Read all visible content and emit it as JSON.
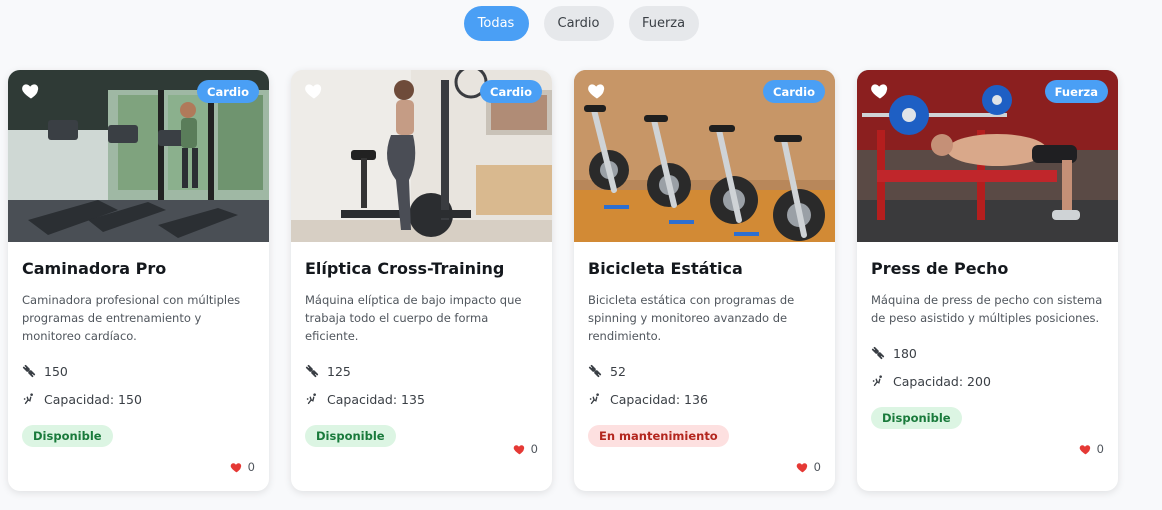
{
  "filters": [
    {
      "label": "Todas",
      "active": true
    },
    {
      "label": "Cardio",
      "active": false
    },
    {
      "label": "Fuerza",
      "active": false
    }
  ],
  "cards": [
    {
      "category": "Cardio",
      "title": "Caminadora Pro",
      "description": "Caminadora profesional con múltiples programas de entrenamiento y monitoreo cardíaco.",
      "weight": "150",
      "capacity": "Capacidad: 150",
      "status": "Disponible",
      "likes": "0",
      "image": "treadmill-row-icon"
    },
    {
      "category": "Cardio",
      "title": "Elíptica Cross-Training",
      "description": "Máquina elíptica de bajo impacto que trabaja todo el cuerpo de forma eficiente.",
      "weight": "125",
      "capacity": "Capacidad: 135",
      "status": "Disponible",
      "likes": "0",
      "image": "elliptical-icon"
    },
    {
      "category": "Cardio",
      "title": "Bicicleta Estática",
      "description": "Bicicleta estática con programas de spinning y monitoreo avanzado de rendimiento.",
      "weight": "52",
      "capacity": "Capacidad: 136",
      "status": "En mantenimiento",
      "likes": "0",
      "image": "spinning-bikes-icon"
    },
    {
      "category": "Fuerza",
      "title": "Press de Pecho",
      "description": "Máquina de press de pecho con sistema de peso asistido y múltiples posiciones.",
      "weight": "180",
      "capacity": "Capacidad: 200",
      "status": "Disponible",
      "likes": "0",
      "image": "bench-press-icon"
    }
  ],
  "colors": {
    "accent": "#4a9ff5",
    "available_bg": "#dcf5e3",
    "available_text": "#197a3b",
    "maintenance_bg": "#fde0e0",
    "maintenance_text": "#b3261e",
    "heart": "#e53935"
  }
}
